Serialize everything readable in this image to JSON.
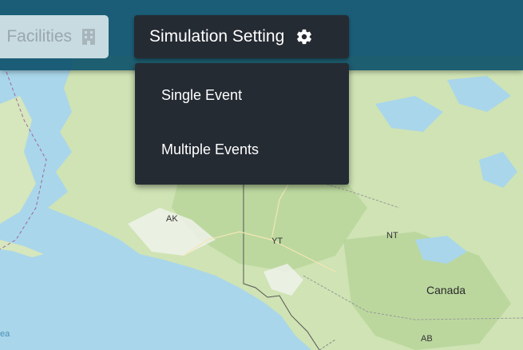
{
  "toolbar": {
    "facilities_label": "Facilities",
    "simulation_label": "Simulation Setting"
  },
  "menu": {
    "items": [
      {
        "label": "Single Event"
      },
      {
        "label": "Multiple Events"
      }
    ]
  },
  "map": {
    "labels": {
      "ak": "AK",
      "yt": "YT",
      "nt": "NT",
      "canada": "Canada",
      "ab": "AB",
      "sea": "ea"
    }
  },
  "colors": {
    "topbar": "#0f526b",
    "button_dark": "#252b33",
    "button_light": "#c7dbe0",
    "water": "#a9d6ea",
    "land": "#cfe3b4"
  },
  "icons": {
    "facilities": "building-icon",
    "simulation": "gear-icon"
  }
}
